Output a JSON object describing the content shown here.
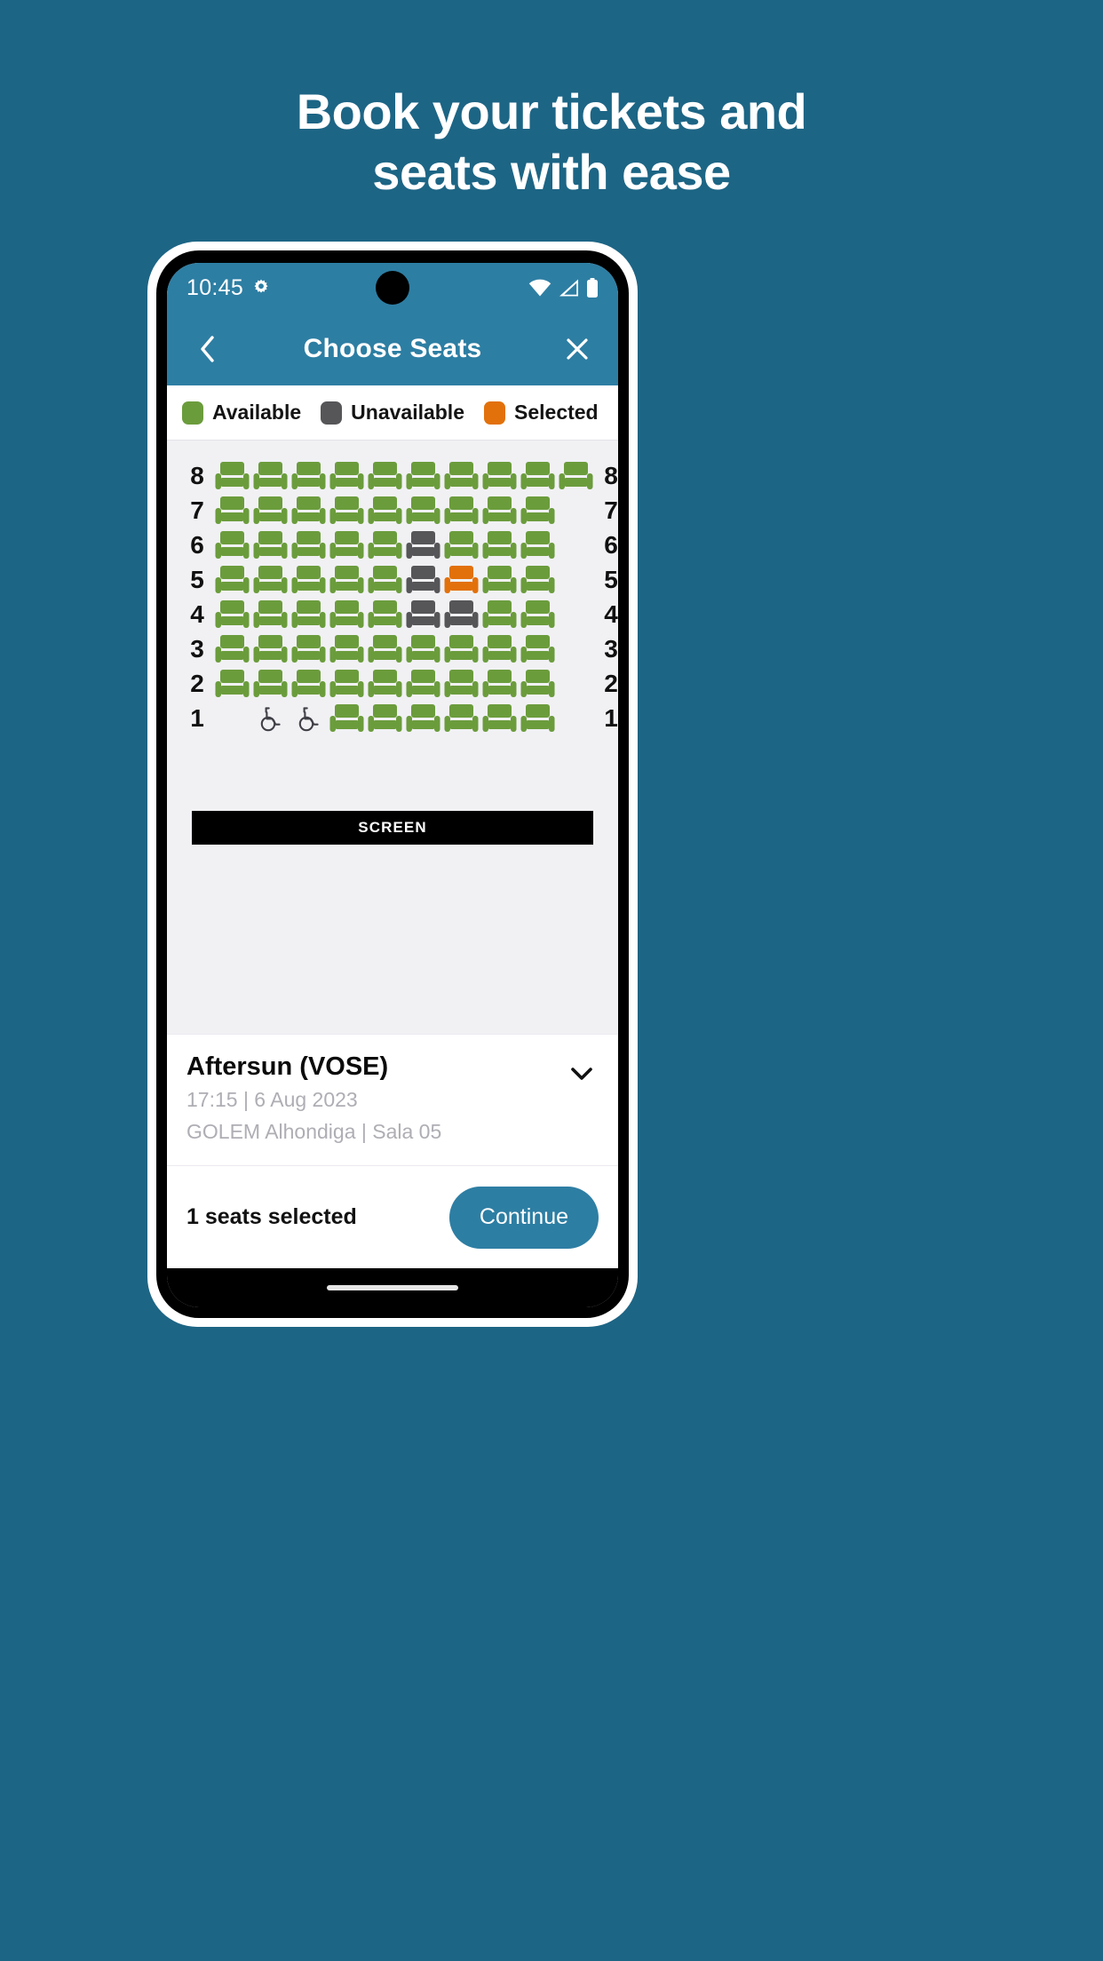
{
  "promo": {
    "line1": "Book your tickets and",
    "line2": "seats with ease"
  },
  "colors": {
    "background": "#1d6585",
    "brand": "#2d7ea3",
    "available": "#6b9c3c",
    "unavailable": "#565659",
    "selected": "#e2710b",
    "screen_bar": "#000000",
    "panel": "#f1f1f4"
  },
  "status_bar": {
    "time": "10:45",
    "icons": [
      "settings-gear-icon",
      "wifi-icon",
      "cellular-signal-icon",
      "battery-icon"
    ]
  },
  "app_bar": {
    "back_icon": "chevron-left-icon",
    "title": "Choose Seats",
    "close_icon": "close-x-icon"
  },
  "legend": [
    {
      "label": "Available",
      "color": "#6b9c3c",
      "state": "available"
    },
    {
      "label": "Unavailable",
      "color": "#565659",
      "state": "unavailable"
    },
    {
      "label": "Selected",
      "color": "#e2710b",
      "state": "selected"
    }
  ],
  "seat_map": {
    "screen_label": "SCREEN",
    "row_labels_left": [
      "8",
      "7",
      "6",
      "5",
      "4",
      "3",
      "2",
      "1"
    ],
    "row_labels_right": [
      "8",
      "7",
      "6",
      "5",
      "4",
      "3",
      "2",
      "1"
    ],
    "rows": [
      {
        "label": "8",
        "seats": [
          "available",
          "available",
          "available",
          "available",
          "available",
          "available",
          "available",
          "available",
          "available",
          "available"
        ]
      },
      {
        "label": "7",
        "seats": [
          "available",
          "available",
          "available",
          "available",
          "available",
          "available",
          "available",
          "available",
          "available",
          "empty"
        ]
      },
      {
        "label": "6",
        "seats": [
          "available",
          "available",
          "available",
          "available",
          "available",
          "unavailable",
          "available",
          "available",
          "available",
          "empty"
        ]
      },
      {
        "label": "5",
        "seats": [
          "available",
          "available",
          "available",
          "available",
          "available",
          "unavailable",
          "selected",
          "available",
          "available",
          "empty"
        ]
      },
      {
        "label": "4",
        "seats": [
          "available",
          "available",
          "available",
          "available",
          "available",
          "unavailable",
          "unavailable",
          "available",
          "available",
          "empty"
        ]
      },
      {
        "label": "3",
        "seats": [
          "available",
          "available",
          "available",
          "available",
          "available",
          "available",
          "available",
          "available",
          "available",
          "empty"
        ]
      },
      {
        "label": "2",
        "seats": [
          "available",
          "available",
          "available",
          "available",
          "available",
          "available",
          "available",
          "available",
          "available",
          "empty"
        ]
      },
      {
        "label": "1",
        "seats": [
          "empty",
          "wheelchair",
          "wheelchair",
          "available",
          "available",
          "available",
          "available",
          "available",
          "available",
          "empty"
        ]
      }
    ]
  },
  "movie": {
    "title": "Aftersun (VOSE)",
    "showtime": "17:15 | 6 Aug 2023",
    "venue": "GOLEM Alhondiga | Sala 05",
    "expand_icon": "chevron-down-icon"
  },
  "footer": {
    "selection_text": "1 seats selected",
    "continue_label": "Continue"
  }
}
